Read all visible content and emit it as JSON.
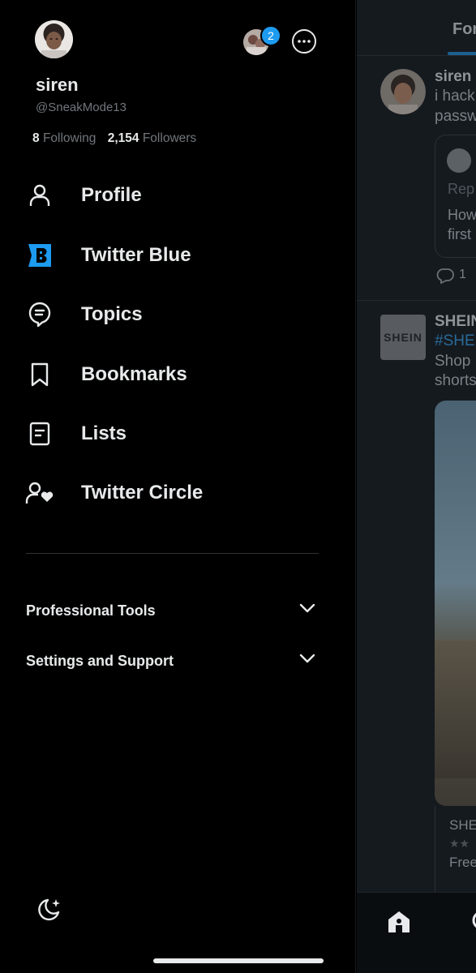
{
  "drawer": {
    "profile": {
      "name": "siren",
      "handle": "@SneakMode13",
      "following_count": "8",
      "following_label": "Following",
      "followers_count": "2,154",
      "followers_label": "Followers"
    },
    "account_switcher": {
      "badge": "2"
    },
    "menu": [
      {
        "label": "Profile",
        "icon": "person-icon"
      },
      {
        "label": "Twitter Blue",
        "icon": "twitter-blue-icon"
      },
      {
        "label": "Topics",
        "icon": "topics-icon"
      },
      {
        "label": "Bookmarks",
        "icon": "bookmark-icon"
      },
      {
        "label": "Lists",
        "icon": "lists-icon"
      },
      {
        "label": "Twitter Circle",
        "icon": "twitter-circle-icon"
      }
    ],
    "sections": [
      {
        "label": "Professional Tools"
      },
      {
        "label": "Settings and Support"
      }
    ]
  },
  "feed": {
    "tab": "For",
    "tweet1": {
      "name": "siren",
      "line1": "i hack",
      "line2": "passw",
      "quote_line1": "Rep",
      "quote_line2": "How",
      "quote_line3": "first",
      "reply_count": "1"
    },
    "tweet2": {
      "name": "SHEIN",
      "logo": "SHEIN",
      "hashtag": "#SHE",
      "line1": "Shop",
      "line2": "shorts",
      "card_title": "SHE",
      "card_line": "Free"
    }
  },
  "colors": {
    "accent": "#1d9bf0",
    "background": "#000000",
    "text": "#e7e9ea",
    "muted": "#71767b"
  }
}
